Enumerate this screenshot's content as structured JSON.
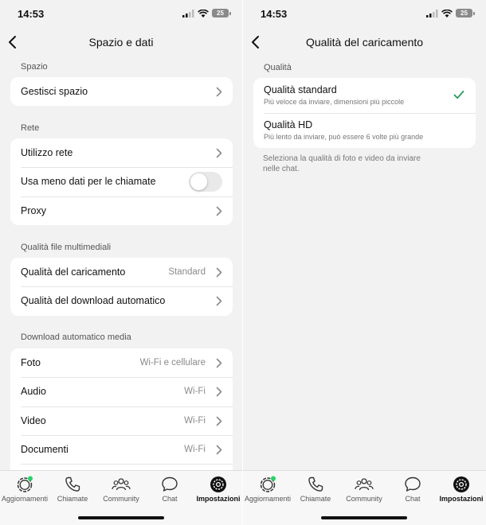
{
  "left": {
    "status": {
      "time": "14:53",
      "battery": "25"
    },
    "nav": {
      "title": "Spazio e dati"
    },
    "sections": {
      "spazio": {
        "label": "Spazio",
        "items": [
          {
            "label": "Gestisci spazio"
          }
        ]
      },
      "rete": {
        "label": "Rete",
        "items": [
          {
            "label": "Utilizzo rete"
          },
          {
            "label": "Usa meno dati per le chiamate",
            "toggle": false
          },
          {
            "label": "Proxy"
          }
        ]
      },
      "qualita": {
        "label": "Qualità file multimediali",
        "items": [
          {
            "label": "Qualità del caricamento",
            "value": "Standard"
          },
          {
            "label": "Qualità del download automatico"
          }
        ]
      },
      "download": {
        "label": "Download automatico media",
        "items": [
          {
            "label": "Foto",
            "value": "Wi-Fi e cellulare"
          },
          {
            "label": "Audio",
            "value": "Wi-Fi"
          },
          {
            "label": "Video",
            "value": "Wi-Fi"
          },
          {
            "label": "Documenti",
            "value": "Wi-Fi"
          }
        ]
      }
    }
  },
  "right": {
    "status": {
      "time": "14:53",
      "battery": "25"
    },
    "nav": {
      "title": "Qualità del caricamento"
    },
    "section_label": "Qualità",
    "options": [
      {
        "title": "Qualità standard",
        "subtitle": "Più veloce da inviare, dimensioni più piccole",
        "selected": true
      },
      {
        "title": "Qualità HD",
        "subtitle": "Più lento da inviare, può essere 6 volte più grande",
        "selected": false
      }
    ],
    "note": "Seleziona la qualità di foto e video da inviare nelle chat."
  },
  "tabs": [
    {
      "label": "Aggiornamenti",
      "icon": "updates-icon"
    },
    {
      "label": "Chiamate",
      "icon": "phone-icon"
    },
    {
      "label": "Community",
      "icon": "community-icon"
    },
    {
      "label": "Chat",
      "icon": "chat-icon"
    },
    {
      "label": "Impostazioni",
      "icon": "settings-icon",
      "active": true
    }
  ],
  "colors": {
    "accent_green": "#25d366",
    "check_green": "#1f9d55",
    "background": "#f2f2f2"
  }
}
